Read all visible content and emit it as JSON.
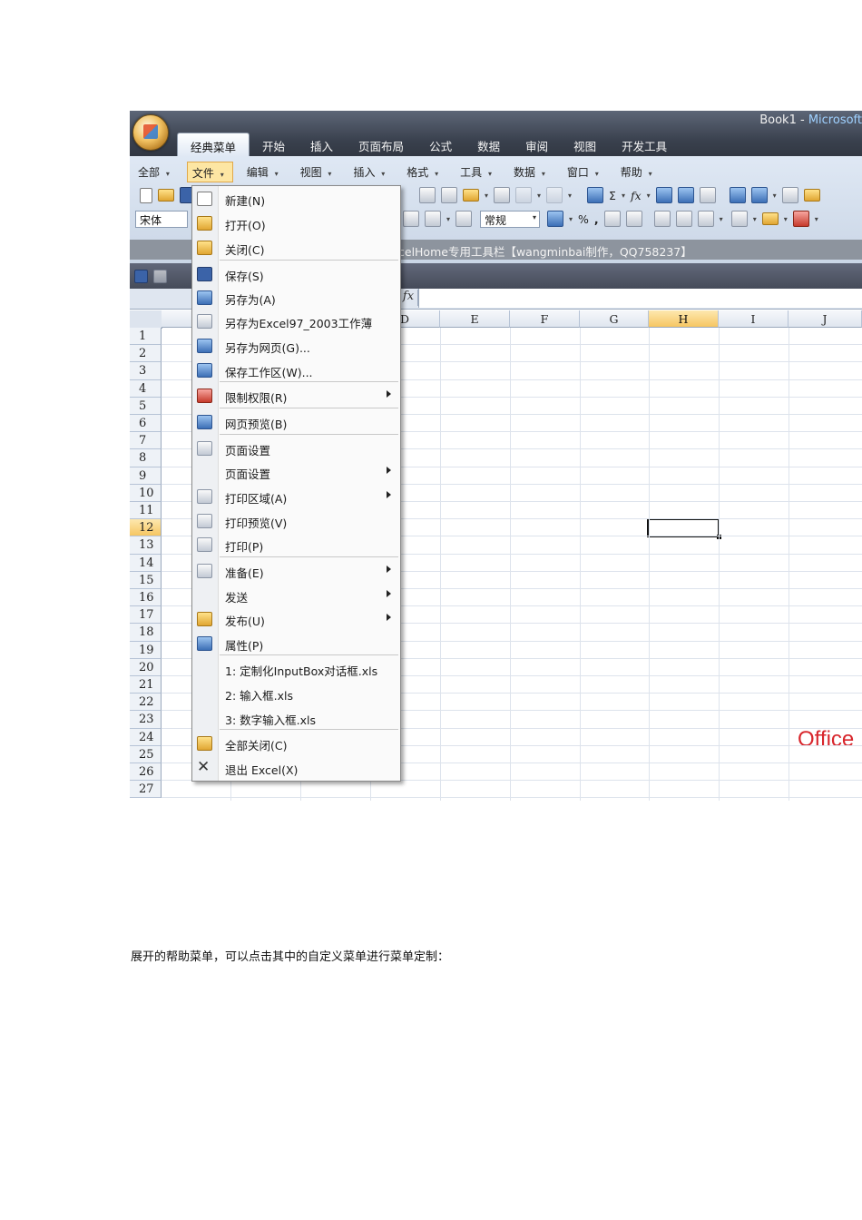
{
  "window": {
    "title": "Book1",
    "separator": " - ",
    "app": "Microsoft"
  },
  "ribbon_tabs": [
    "经典菜单",
    "开始",
    "插入",
    "页面布局",
    "公式",
    "数据",
    "审阅",
    "视图",
    "开发工具"
  ],
  "classic_menubar": [
    "全部",
    "文件",
    "编辑",
    "视图",
    "插入",
    "格式",
    "工具",
    "数据",
    "窗口",
    "帮助"
  ],
  "toolbar": {
    "font_name": "宋体",
    "number_format": "常规",
    "sigma": "Σ",
    "fx": "fx",
    "percent": "%",
    "comma": ","
  },
  "addin_bar_text": "celHome专用工具栏【wangminbai制作，QQ758237】",
  "formula_bar": {
    "fx_label": "fx"
  },
  "grid": {
    "columns": [
      "D",
      "E",
      "F",
      "G",
      "H",
      "I",
      "J"
    ],
    "selected_column": "H",
    "rows": [
      "1",
      "2",
      "3",
      "4",
      "5",
      "6",
      "7",
      "8",
      "9",
      "10",
      "11",
      "12",
      "13",
      "14",
      "15",
      "16",
      "17",
      "18",
      "19",
      "20",
      "21",
      "22",
      "23",
      "24",
      "25",
      "26",
      "27"
    ],
    "selected_row": "12"
  },
  "file_menu": {
    "items": [
      {
        "label": "新建(N)",
        "icon": "new-doc-icon"
      },
      {
        "label": "打开(O)",
        "icon": "open-folder-icon"
      },
      {
        "label": "关闭(C)",
        "icon": "close-folder-icon"
      },
      {
        "label": "保存(S)",
        "icon": "save-disk-icon"
      },
      {
        "label": "另存为(A)",
        "icon": "save-as-icon"
      },
      {
        "label": "另存为Excel97_2003工作薄",
        "icon": "save-as-97-icon"
      },
      {
        "label": "另存为网页(G)...",
        "icon": "save-web-icon"
      },
      {
        "label": "保存工作区(W)...",
        "icon": "save-workspace-icon"
      },
      {
        "label": "限制权限(R)",
        "icon": "permission-icon",
        "submenu": true
      },
      {
        "label": "网页预览(B)",
        "icon": "web-preview-icon"
      },
      {
        "label": "页面设置",
        "icon": "page-setup-icon"
      },
      {
        "label": "页面设置",
        "icon": "",
        "submenu": true
      },
      {
        "label": "打印区域(A)",
        "icon": "print-area-icon",
        "submenu": true
      },
      {
        "label": "打印预览(V)",
        "icon": "print-preview-icon"
      },
      {
        "label": "打印(P)",
        "icon": "printer-icon"
      },
      {
        "label": "准备(E)",
        "icon": "prepare-icon",
        "submenu": true
      },
      {
        "label": "发送",
        "icon": "",
        "submenu": true
      },
      {
        "label": "发布(U)",
        "icon": "publish-icon",
        "submenu": true
      },
      {
        "label": "属性(P)",
        "icon": "properties-icon"
      },
      {
        "label": "1: 定制化InputBox对话框.xls",
        "icon": ""
      },
      {
        "label": "2: 输入框.xls",
        "icon": ""
      },
      {
        "label": "3: 数字输入框.xls",
        "icon": ""
      },
      {
        "label": "全部关闭(C)",
        "icon": "close-all-icon"
      },
      {
        "label": "退出 Excel(X)",
        "icon": "exit-icon"
      }
    ]
  },
  "watermark": "Office",
  "caption": "展开的帮助菜单，可以点击其中的自定义菜单进行菜单定制："
}
